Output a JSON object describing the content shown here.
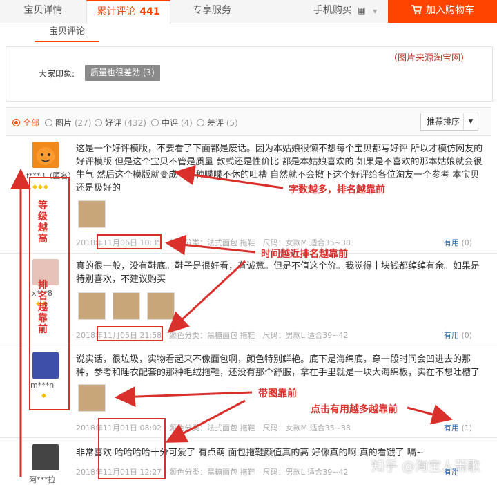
{
  "tabs": {
    "detail": "宝贝详情",
    "reviews_label": "累计评论",
    "reviews_count": "441",
    "service": "专享服务",
    "mobile": "手机购买",
    "cart": "加入购物车"
  },
  "sub_tab": "宝贝评论",
  "impression": {
    "label": "大家印象:",
    "tag": "质量也很差劲 (3)",
    "source_note": "（图片来源淘宝网）"
  },
  "filters": [
    {
      "label": "全部",
      "count": ""
    },
    {
      "label": "图片",
      "count": "(27)"
    },
    {
      "label": "好评",
      "count": "(432)"
    },
    {
      "label": "中评",
      "count": "(4)"
    },
    {
      "label": "差评",
      "count": "(5)"
    }
  ],
  "sort_label": "推荐排序",
  "reviews": [
    {
      "user": "f***3（匿名）",
      "text": "这是一个好评模版，不要看了下面都是废话。因为本姑娘很懒不想每个宝贝都写好评 所以才模仿网友的 好评模版 但是这个宝贝不管是质量 款式还是性价比 都是本姑娘喜欢的 如果是不喜欢的那本姑娘就会很生气 然后这个模版就变成了各种喋喋不休的吐槽 自然就不会撤下这个好评给各位淘友一个参考 本宝贝还是极好的",
      "date": "2018年11月06日 10:35",
      "spec": "颜色分类：法式面包 拖鞋　尺码：女款M 适合35~38",
      "useful": "有用",
      "useful_count": "(0)"
    },
    {
      "user": "x***8",
      "text": "真的很一般，没有鞋底。鞋子是很好看，有诚意。但是不值这个价。我觉得十块钱都绰绰有余。如果是特别喜欢，不建议购买",
      "date": "2018年11月05日 21:58",
      "spec": "颜色分类：黑糖面包 拖鞋　尺码：男款L 适合39~42",
      "useful": "有用",
      "useful_count": "(0)"
    },
    {
      "user": "m***n",
      "text": "说实话，很垃圾，实物看起来不像面包啊，颜色特别鲜艳。底下是海绵底，穿一段时间会凹进去的那种，参考和睡衣配套的那种毛绒拖鞋，还没有那个舒服，拿在手里就是一块大海绵板，实在不想吐槽了",
      "date": "2018年11月01日 08:02",
      "spec": "颜色分类：法式面包 拖鞋　尺码：女款M 适合35~38",
      "useful": "有用",
      "useful_count": "(1)"
    },
    {
      "user": "阿***拉",
      "text": "非常喜欢 哈哈哈哈十分可爱了 有点萌 面包拖鞋颜值真的高 好像真的啊 真的看饿了 嗝~",
      "date": "2018年11月01日 12:27",
      "spec": "颜色分类：黑糖面包 拖鞋　尺码：男款L 适合39~42",
      "useful": "有用",
      "useful_count": ""
    }
  ],
  "annotations": {
    "word_count": "字数越多，排名越靠前",
    "time": "时间越近排名越靠前",
    "with_image": "带图靠前",
    "useful": "点击有用越多越靠前",
    "level": "等级越高",
    "rank": "排名越靠前"
  },
  "watermark": "知乎 @淘宝人萧歌",
  "colors": {
    "accent": "#ff4400",
    "annotation": "#d9302c",
    "link": "#2a6bb8"
  }
}
